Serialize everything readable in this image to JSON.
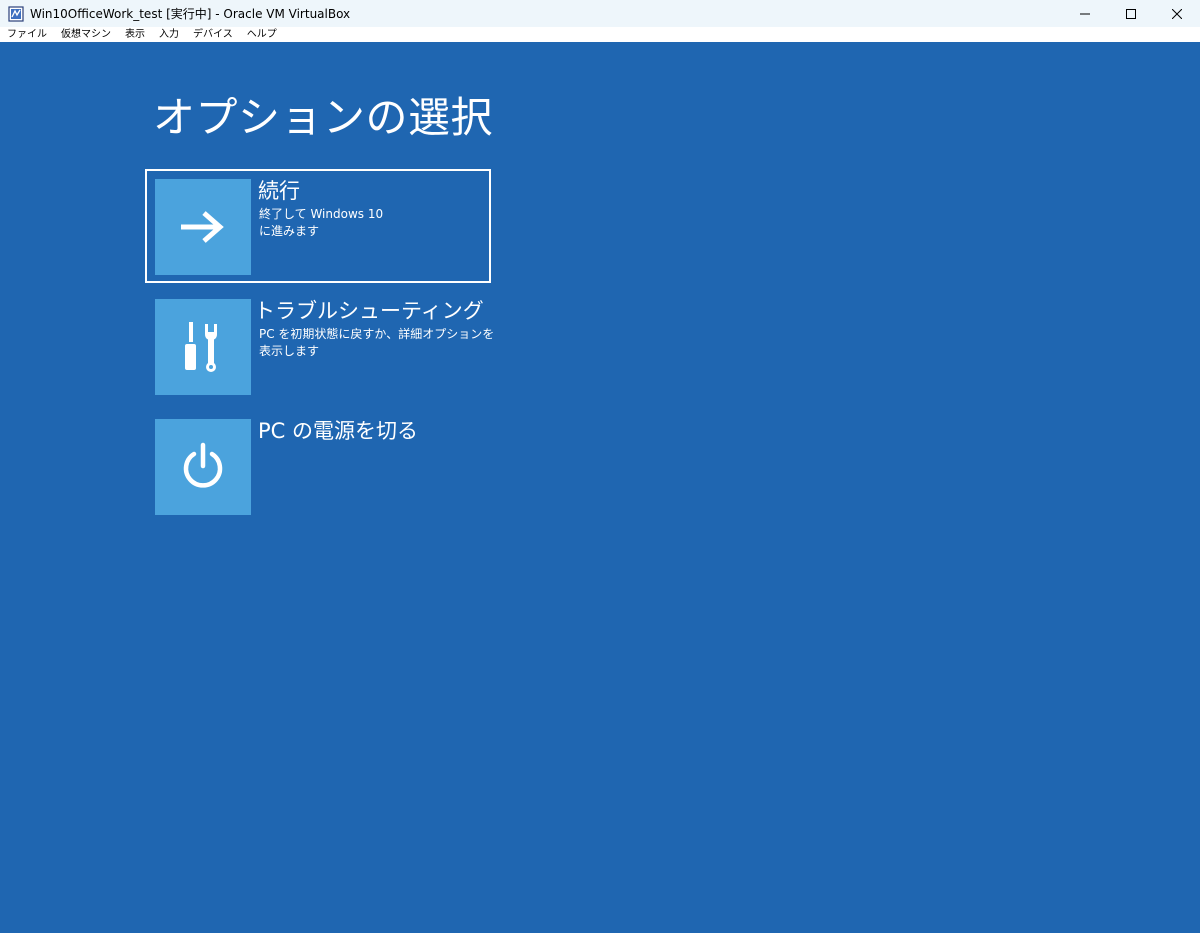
{
  "window": {
    "title": "Win10OfficeWork_test [実行中] - Oracle VM VirtualBox",
    "controls": {
      "minimize_icon": "minimize-icon",
      "maximize_icon": "maximize-icon",
      "close_icon": "close-icon"
    }
  },
  "menubar": {
    "items": [
      "ファイル",
      "仮想マシン",
      "表示",
      "入力",
      "デバイス",
      "ヘルプ"
    ]
  },
  "screen": {
    "background": "#1f66b1",
    "tile_color": "#4ba3dd",
    "heading": "オプションの選択",
    "options": [
      {
        "title": "続行",
        "desc_line1": "終了して Windows 10",
        "desc_line2": "に進みます",
        "icon": "arrow-right-icon",
        "selected": true
      },
      {
        "title": "トラブルシューティング",
        "desc_line1": "PC を初期状態に戻すか、詳細オプションを",
        "desc_line2": "表示します",
        "icon": "tools-icon",
        "selected": false
      },
      {
        "title": "PC の電源を切る",
        "desc_line1": "",
        "desc_line2": "",
        "icon": "power-icon",
        "selected": false
      }
    ]
  }
}
